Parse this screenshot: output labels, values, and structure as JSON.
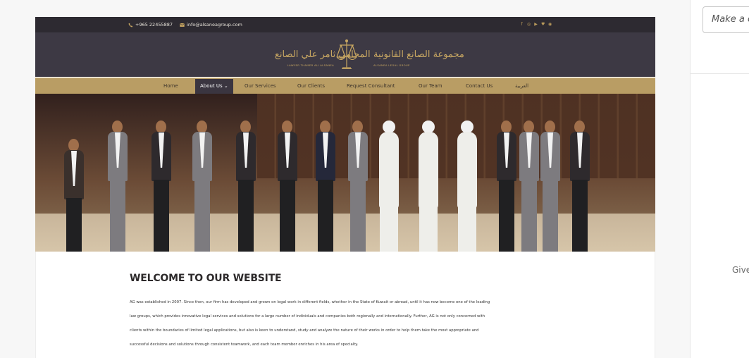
{
  "site": {
    "phone": "+965 22455887",
    "email": "info@alsaneagroup.com",
    "social_icons": [
      "facebook-icon",
      "instagram-icon",
      "youtube-icon",
      "twitter-icon",
      "whatsapp-icon"
    ],
    "logo": {
      "left_arabic": "المحامي ثامر علي الصانع",
      "left_english": "LAWYER THAMER ALI ALSANEA",
      "right_arabic": "مجموعة الصانع القانونية",
      "right_english": "ALSANEA LEGAL GROUP"
    },
    "nav": [
      {
        "label": "Home"
      },
      {
        "label": "About Us ⌄"
      },
      {
        "label": "Our Services"
      },
      {
        "label": "Our Clients"
      },
      {
        "label": "Request Consultant"
      },
      {
        "label": "Our Team"
      },
      {
        "label": "Contact Us"
      },
      {
        "label": "العربية"
      }
    ],
    "welcome": {
      "title": "WELCOME TO OUR WEBSITE",
      "lines": [
        "AG was established in 2007. Since then, our firm has developed and grown on legal work in different fields, whether in the State of Kuwait or abroad, until it has now become one of the leading",
        "law groups, which provides innovative legal services and solutions for a large number of individuals and companies both regionally and internationally. Further, AG is not only concerned with",
        "clients within the boundaries of limited legal applications, but also is keen to understand, study and analyze the nature of their works in order to help them take the most appropriate and",
        "successful decisions and solutions through consistent teamwork, and each team member enriches in his area of specialty."
      ]
    }
  },
  "side_panel": {
    "input_placeholder": "Make a co",
    "partial_text": "Give"
  },
  "colors": {
    "topbar": "#2d2a31",
    "header": "#3d3944",
    "gold": "#c8a762",
    "nav": "#b99d64",
    "active_nav": "#3a3540"
  }
}
